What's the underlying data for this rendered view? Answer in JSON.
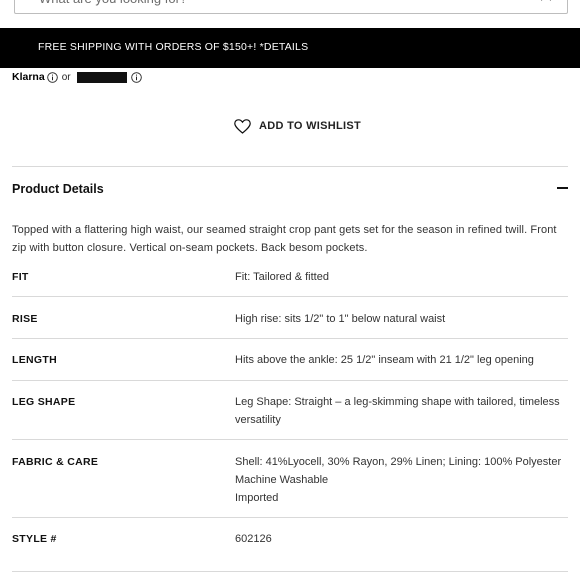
{
  "search": {
    "placeholder": "What are you looking for?"
  },
  "icons": {
    "close": "close-icon",
    "info": "info-icon",
    "heart": "heart-icon",
    "minus": "minus-icon"
  },
  "promo": {
    "text": "FREE SHIPPING WITH ORDERS OF $150+! *DETAILS"
  },
  "payment": {
    "brand": "Klarna",
    "or_text": "or"
  },
  "wishlist": {
    "label": "ADD TO WISHLIST"
  },
  "product_details": {
    "title": "Product Details",
    "description": "Topped with a flattering high waist, our seamed straight crop pant gets set for the season in refined twill. Front zip with button closure. Vertical on-seam pockets. Back besom pockets.",
    "specs": [
      {
        "label": "FIT",
        "values": [
          "Fit: Tailored & fitted"
        ]
      },
      {
        "label": "RISE",
        "values": [
          "High rise: sits 1/2\" to 1\" below natural waist"
        ]
      },
      {
        "label": "LENGTH",
        "values": [
          "Hits above the ankle: 25 1/2\" inseam with 21 1/2\" leg opening"
        ]
      },
      {
        "label": "LEG SHAPE",
        "values": [
          "Leg Shape: Straight – a leg-skimming shape with tailored, timeless versatility"
        ]
      },
      {
        "label": "FABRIC & CARE",
        "values": [
          "Shell: 41%Lyocell, 30% Rayon, 29% Linen; Lining: 100% Polyester",
          "Machine Washable",
          "Imported"
        ]
      },
      {
        "label": "STYLE #",
        "values": [
          "602126"
        ]
      }
    ]
  },
  "colors": {
    "promo_bg": "#000000",
    "promo_text": "#ffffff",
    "divider": "#d9d9d9",
    "text": "#222222"
  }
}
